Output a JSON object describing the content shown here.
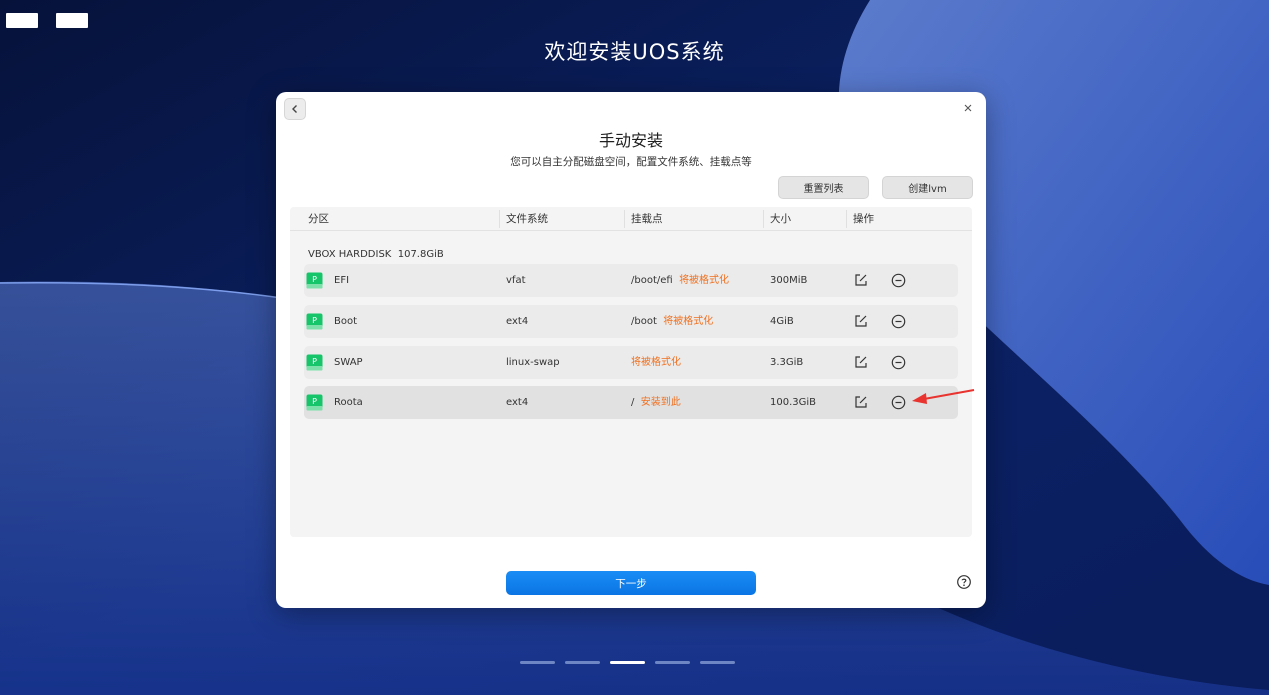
{
  "header": {
    "title": "欢迎安装UOS系统"
  },
  "dialog": {
    "title": "手动安装",
    "subtitle": "您可以自主分配磁盘空间，配置文件系统、挂载点等",
    "buttons": {
      "reset": "重置列表",
      "create_lvm": "创建lvm",
      "next": "下一步"
    }
  },
  "table": {
    "headers": {
      "partition": "分区",
      "filesystem": "文件系统",
      "mountpoint": "挂载点",
      "size": "大小",
      "actions": "操作"
    },
    "disk": {
      "name": "VBOX HARDDISK",
      "size": "107.8GiB"
    },
    "rows": [
      {
        "name": "EFI",
        "filesystem": "vfat",
        "mount": "/boot/efi",
        "status": "将被格式化",
        "size": "300MiB",
        "selected": false
      },
      {
        "name": "Boot",
        "filesystem": "ext4",
        "mount": "/boot",
        "status": "将被格式化",
        "size": "4GiB",
        "selected": false
      },
      {
        "name": "SWAP",
        "filesystem": "linux-swap",
        "mount": "",
        "status": "将被格式化",
        "size": "3.3GiB",
        "selected": false
      },
      {
        "name": "Roota",
        "filesystem": "ext4",
        "mount": "/",
        "status": "安装到此",
        "size": "100.3GiB",
        "selected": true
      }
    ]
  },
  "partition_icon_letter": "P",
  "progress": {
    "total_steps": 5,
    "current_step": 3
  },
  "colors": {
    "accent": "#0a74e4",
    "warning": "#f07020",
    "partition_icon": "#16c46a",
    "annotation_arrow": "#e8332f"
  },
  "icons": {
    "back": "chevron-left-icon",
    "close": "close-icon",
    "edit": "edit-icon",
    "delete": "minus-circle-icon",
    "help": "help-icon"
  }
}
